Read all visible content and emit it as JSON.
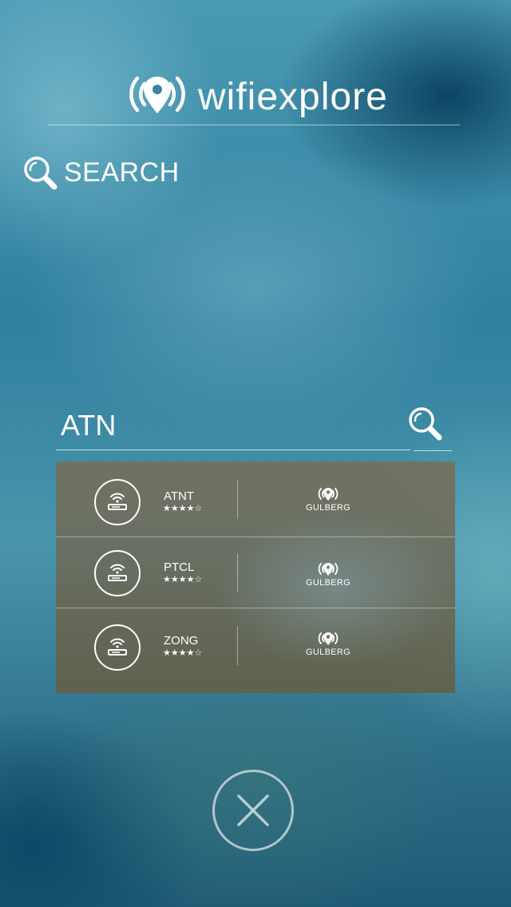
{
  "app": {
    "name": "wifiexplore"
  },
  "search_heading": {
    "label": "SEARCH",
    "icon": "search-icon"
  },
  "query": {
    "value": "ATN",
    "button_icon": "search-icon"
  },
  "results": [
    {
      "name": "ATNT",
      "rating_text": "★★★★☆",
      "rating": 4,
      "rating_max": 5,
      "location": "GULBERG",
      "icon": "wifi-router-icon",
      "location_icon": "wifi-location-pin-icon"
    },
    {
      "name": "PTCL",
      "rating_text": "★★★★☆",
      "rating": 4,
      "rating_max": 5,
      "location": "GULBERG",
      "icon": "wifi-router-icon",
      "location_icon": "wifi-location-pin-icon"
    },
    {
      "name": "ZONG",
      "rating_text": "★★★★☆",
      "rating": 4,
      "rating_max": 5,
      "location": "GULBERG",
      "icon": "wifi-router-icon",
      "location_icon": "wifi-location-pin-icon"
    }
  ],
  "close": {
    "icon": "close-icon"
  },
  "colors": {
    "text": "#ffffff",
    "background_top": "#4b9ab4",
    "background_bottom": "#1f5a75",
    "results_panel": "#6e6955"
  }
}
